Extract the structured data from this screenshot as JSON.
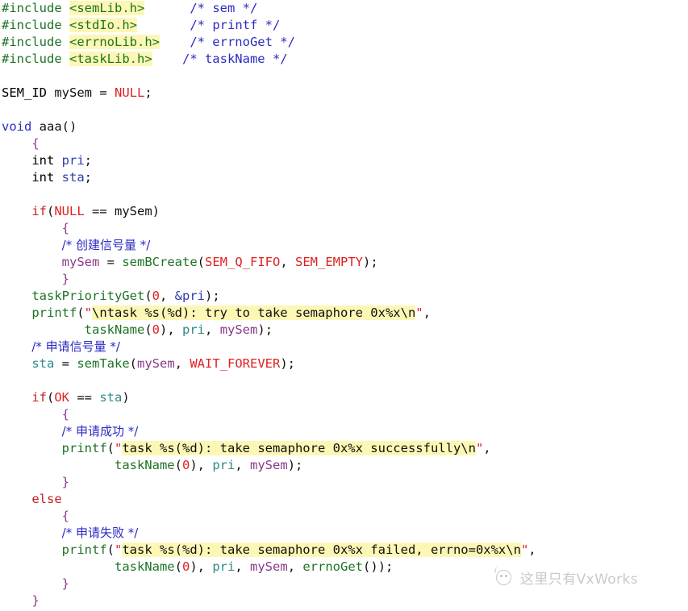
{
  "document": {
    "kind": "source-code-listing",
    "language": "C",
    "title": "VxWorks semaphore example (aaa)"
  },
  "colors": {
    "background": "#ffffff",
    "preprocessor": "#1d7324",
    "comment": "#2b2bc0",
    "keyword_red": "#c02020",
    "keyword_blue": "#2b2bc0",
    "macro": "#e02020",
    "function": "#1d7324",
    "string_highlight": "#fdf7b5",
    "string_text": "#101010",
    "quote": "#e02020",
    "variable_mauve": "#8a3a8a",
    "variable_teal": "#2b8a8a",
    "variable_blue": "#2b3bb0",
    "brace": "#8a3a8a",
    "watermark": "#9d9d9d"
  },
  "code": {
    "lines": [
      "#include <semLib.h>      /* sem */",
      "#include <stdIo.h>       /* printf */",
      "#include <errnoLib.h>    /* errnoGet */",
      "#include <taskLib.h>     /* taskName */",
      "",
      "SEM_ID mySem = NULL;",
      "",
      "void aaa()",
      "    {",
      "    int pri;",
      "    int sta;",
      "",
      "    if(NULL == mySem)",
      "        {",
      "        /* 创建信号量 */",
      "        mySem = semBCreate(SEM_Q_FIFO, SEM_EMPTY);",
      "        }",
      "    taskPriorityGet(0, &pri);",
      "    printf(\"\\ntask %s(%d): try to take semaphore 0x%x\\n\",",
      "           taskName(0), pri, mySem);",
      "    /* 申请信号量 */",
      "    sta = semTake(mySem, WAIT_FOREVER);",
      "",
      "    if(OK == sta)",
      "        {",
      "        /* 申请成功 */",
      "        printf(\"task %s(%d): take semaphore 0x%x successfully\\n\",",
      "               taskName(0), pri, mySem);",
      "        }",
      "    else",
      "        {",
      "        /* 申请失败 */",
      "        printf(\"task %s(%d): take semaphore 0x%x failed, errno=0x%x\\n\",",
      "               taskName(0), pri, mySem, errnoGet());",
      "        }",
      "    }"
    ],
    "includes": [
      {
        "directive": "#include",
        "header": "<semLib.h>",
        "comment": "/* sem */"
      },
      {
        "directive": "#include",
        "header": "<stdIo.h>",
        "comment": "/* printf */"
      },
      {
        "directive": "#include",
        "header": "<errnoLib.h>",
        "comment": "/* errnoGet */"
      },
      {
        "directive": "#include",
        "header": "<taskLib.h>",
        "comment": "/* taskName */"
      }
    ],
    "globals": [
      {
        "type": "SEM_ID",
        "name": "mySem",
        "value": "NULL"
      }
    ],
    "function": {
      "return_type": "void",
      "name": "aaa",
      "params": "()",
      "locals": [
        "int pri;",
        "int sta;"
      ]
    },
    "chinese_comments": [
      "/* 创建信号量 */",
      "/* 申请信号量 */",
      "/* 申请成功 */",
      "/* 申请失败 */"
    ],
    "strings": [
      "\\ntask %s(%d): try to take semaphore 0x%x\\n",
      "task %s(%d): take semaphore 0x%x successfully\\n",
      "task %s(%d): take semaphore 0x%x failed, errno=0x%x\\n"
    ],
    "macros_used": [
      "NULL",
      "SEM_Q_FIFO",
      "SEM_EMPTY",
      "WAIT_FOREVER",
      "OK"
    ],
    "functions_called": [
      "semBCreate",
      "taskPriorityGet",
      "printf",
      "taskName",
      "semTake",
      "errnoGet"
    ]
  },
  "tokens": {
    "hash_include": "#include",
    "h_semlib": "<semLib.h>",
    "h_stdio": "<stdIo.h>",
    "h_errnolib": "<errnoLib.h>",
    "h_tasklib": "<taskLib.h>",
    "c_sem": "/* sem */",
    "c_printf": "/* printf */",
    "c_errnoget": "/* errnoGet */",
    "c_taskname": "/* taskName */",
    "sem_id": "SEM_ID",
    "mysem": "mySem",
    "eq": " = ",
    "null": "NULL",
    "semi": ";",
    "void": "void",
    "aaa": " aaa()",
    "brace_open": "{",
    "brace_close": "}",
    "int": "int",
    "pri": "pri",
    "sta": "sta",
    "if": "if",
    "paren_open": "(",
    "paren_close": ")",
    "eqeq": " == ",
    "cn_create": "/* 创建信号量 */",
    "cn_request": "/* 申请信号量 */",
    "cn_success": "/* 申请成功 */",
    "cn_fail": "/* 申请失败 */",
    "sembcreate": "semBCreate",
    "sem_q_fifo": "SEM_Q_FIFO",
    "sem_empty": "SEM_EMPTY",
    "comma_sp": ", ",
    "taskpriorityget": "taskPriorityGet",
    "zero": "0",
    "amp_pri": "&pri",
    "printf": "printf",
    "quote": "\"",
    "str1": "\\ntask %s(%d): try to take semaphore 0x%x\\n",
    "str2": "task %s(%d): take semaphore 0x%x successfully\\n",
    "str3": "task %s(%d): take semaphore 0x%x failed, errno=0x%x\\n",
    "comma": ",",
    "taskname": "taskName",
    "semtake": "semTake",
    "wait_forever": "WAIT_FOREVER",
    "ok": "OK",
    "else": "else",
    "errnoget": "errnoGet",
    "empty_parens": "()"
  },
  "watermark": {
    "text": "这里只有VxWorks",
    "logo": "circle-face-icon"
  }
}
